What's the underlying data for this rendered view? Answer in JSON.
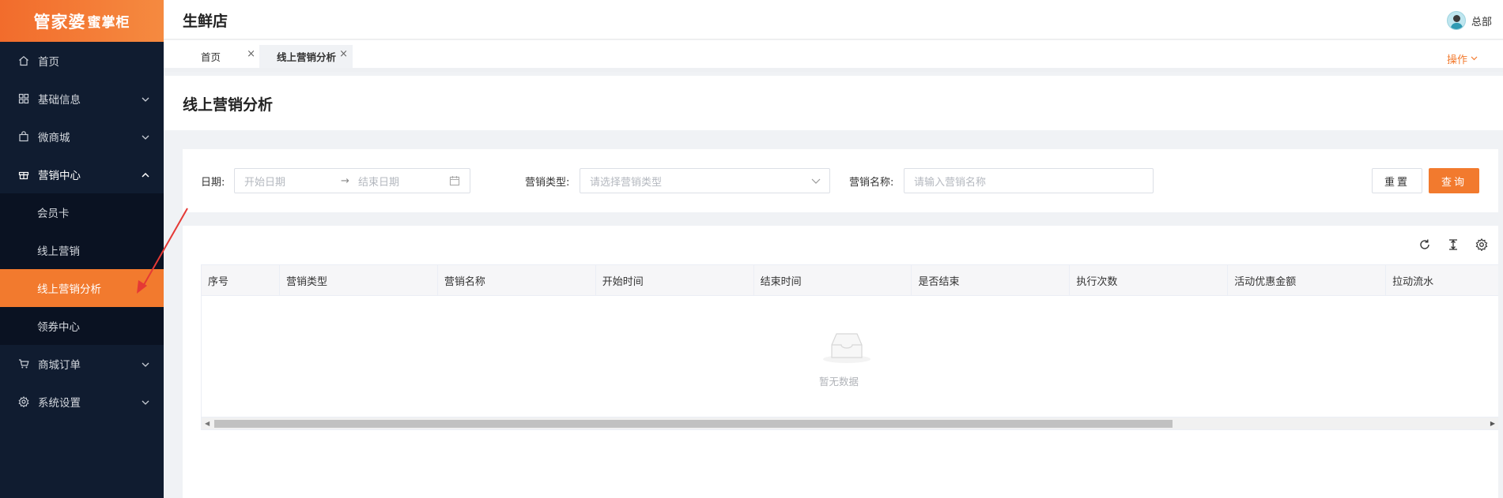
{
  "brand": {
    "logo_main": "管家婆",
    "logo_sub": "蜜掌柜"
  },
  "header": {
    "store_name": "生鲜店",
    "user_name": "总部"
  },
  "sidebar": {
    "items": [
      {
        "label": "首页",
        "icon": "home-icon"
      },
      {
        "label": "基础信息",
        "icon": "grid-icon"
      },
      {
        "label": "微商城",
        "icon": "bag-icon"
      },
      {
        "label": "营销中心",
        "icon": "gift-icon"
      },
      {
        "label": "商城订单",
        "icon": "cart-icon"
      },
      {
        "label": "系统设置",
        "icon": "gear-icon"
      }
    ],
    "submenu": [
      "会员卡",
      "线上营销",
      "线上营销分析",
      "领券中心"
    ]
  },
  "tabs": {
    "home": "首页",
    "active": "线上营销分析",
    "close": "×",
    "operation": "操作"
  },
  "page": {
    "title": "线上营销分析"
  },
  "filters": {
    "date_label": "日期:",
    "start_placeholder": "开始日期",
    "arrow": "→",
    "end_placeholder": "结束日期",
    "type_label": "营销类型:",
    "type_placeholder": "请选择营销类型",
    "name_label": "营销名称:",
    "name_placeholder": "请输入营销名称",
    "reset": "重置",
    "query": "查询"
  },
  "table": {
    "columns": [
      "序号",
      "营销类型",
      "营销名称",
      "开始时间",
      "结束时间",
      "是否结束",
      "执行次数",
      "活动优惠金额",
      "拉动流水"
    ],
    "empty_text": "暂无数据"
  },
  "colors": {
    "accent": "#f27a2e",
    "sidebar_bg": "#101c30"
  }
}
